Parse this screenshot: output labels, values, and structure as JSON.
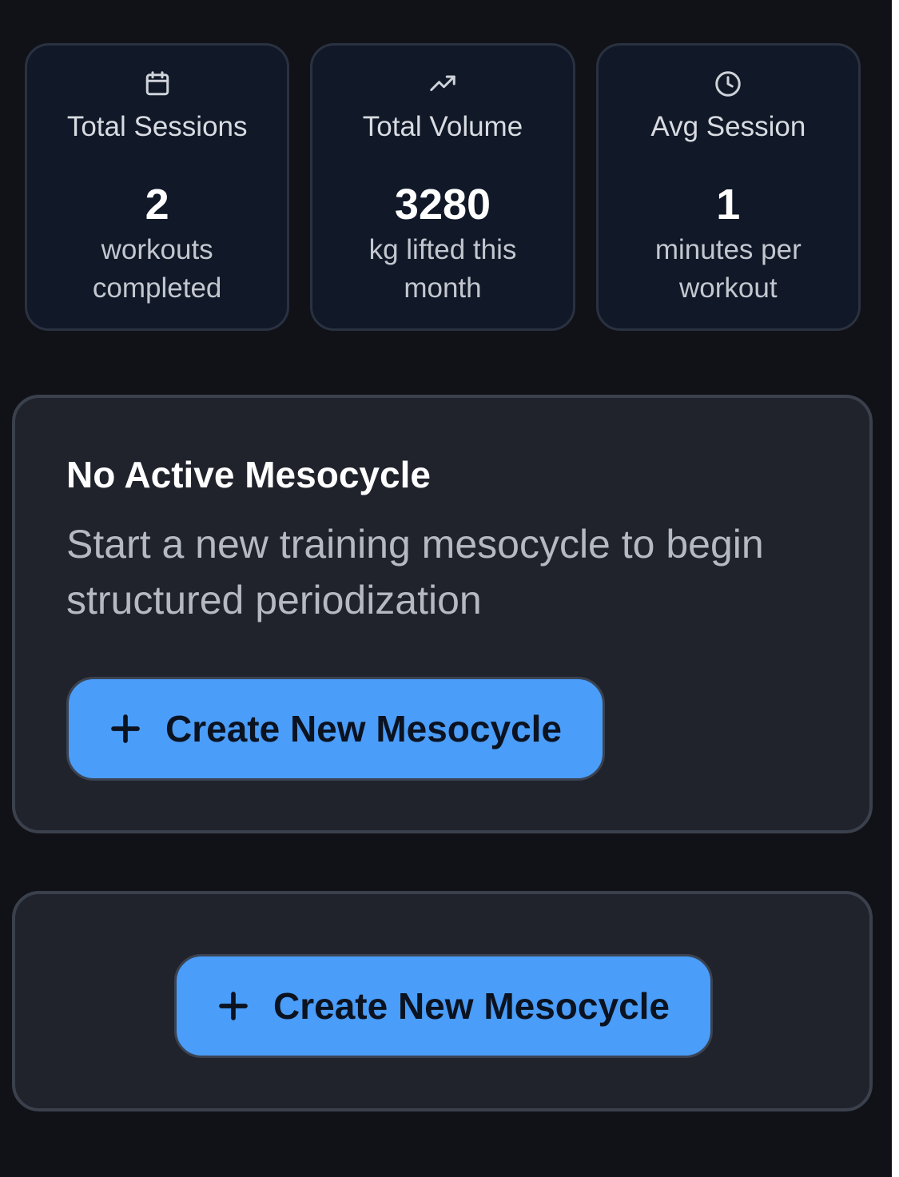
{
  "stats": [
    {
      "icon": "calendar-icon",
      "title": "Total Sessions",
      "value": "2",
      "caption": "workouts completed"
    },
    {
      "icon": "trending-up-icon",
      "title": "Total Volume",
      "value": "3280",
      "caption": "kg lifted this month"
    },
    {
      "icon": "clock-icon",
      "title": "Avg Session",
      "value": "1",
      "caption": "minutes per workout"
    }
  ],
  "mesocycle_panel": {
    "title": "No Active Mesocycle",
    "description": "Start a new training mesocycle to begin structured periodization",
    "button_label": "Create New Mesocycle"
  },
  "secondary_panel": {
    "button_label": "Create New Mesocycle"
  },
  "colors": {
    "background": "#111217",
    "card": "#111827",
    "panel": "#20232c",
    "primary_button": "#4a9df8",
    "border": "#3b414c"
  }
}
